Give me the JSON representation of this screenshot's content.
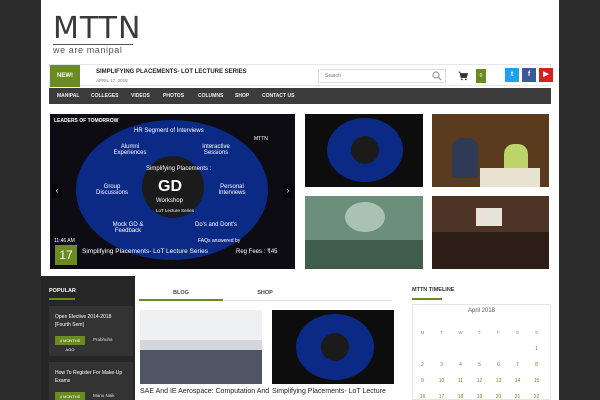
{
  "header": {
    "logo_main": "MTTN",
    "logo_sub": "we are manipal"
  },
  "newsbar": {
    "badge": "NEW!",
    "headline": "SIMPLIFYING PLACEMENTS- LOT LECTURE SERIES",
    "date": "APRIL 17, 2018",
    "search_placeholder": "Search",
    "cart_count": "0",
    "social": [
      "t",
      "f",
      "▶"
    ]
  },
  "nav": {
    "items": [
      "MANIPAL",
      "COLLEGES",
      "VIDEOS",
      "PHOTOS",
      "COLUMNS",
      "SHOP",
      "CONTACT US"
    ]
  },
  "hero": {
    "poster_heading": "HR Segment of Interviews",
    "labels": [
      "Alumni Experiences",
      "Interactive Sessions",
      "Group Discussions",
      "Personal Interviews",
      "Mock GD & Feedback",
      "Do's and Dont's"
    ],
    "center_top": "Simplifying Placements :",
    "center_gd": "GD",
    "center_bottom": "Workshop",
    "series": "LoT Lecture Series",
    "brand": "LEADERS OF TOMORROW",
    "brand_mark": "MTTN",
    "time": "11:46 AM",
    "day": "17",
    "caption": "Simplifying Placements- LoT Lecture Series",
    "reg_fees": "Reg Fees : ₹45",
    "faqs": "FAQs answered by",
    "arrows": [
      "‹",
      "›"
    ]
  },
  "popular": {
    "title": "POPULAR",
    "items": [
      {
        "title": "Open Elective 2014-2018 [Fourth Sem]",
        "meta": "4 MONTHS AGO",
        "author": "Prabhuha"
      },
      {
        "title": "How To Register For Make-Up Exams",
        "meta": "4 MONTHS AGO",
        "author": "Manu Naik"
      }
    ]
  },
  "tabs": {
    "blog": "BLOG",
    "shop": "SHOP"
  },
  "posts": [
    {
      "title": "SAE And IE Aerospace: Computation And"
    },
    {
      "title": "Simplifying Placements- LoT Lecture"
    }
  ],
  "timeline": {
    "title": "MTTN TIMELINE",
    "month": "April 2018",
    "weekdays": [
      "M",
      "T",
      "W",
      "T",
      "F",
      "S",
      "S"
    ],
    "weeks": [
      [
        "",
        "",
        "",
        "",
        "",
        "",
        "1"
      ],
      [
        "2",
        "3",
        "4",
        "5",
        "6",
        "7",
        "8"
      ],
      [
        "9",
        "10",
        "11",
        "12",
        "13",
        "14",
        "15"
      ],
      [
        "16",
        "17",
        "18",
        "19",
        "20",
        "21",
        "22"
      ]
    ]
  },
  "colors": {
    "accent": "#6a8a22",
    "nav_bg": "#3c3c3c",
    "page_bg": "#2b2b2b"
  }
}
